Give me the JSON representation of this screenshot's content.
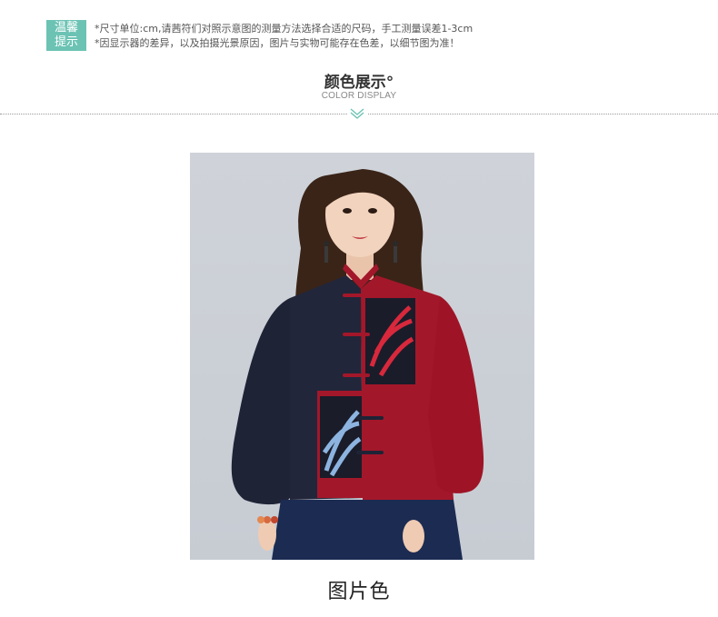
{
  "tip": {
    "badge_line1": "温馨",
    "badge_line2": "提示",
    "line1": "*尺寸单位:cm,请茜符们对照示意图的测量方法选择合适的尺码，手工测量误差1-3cm",
    "line2": "*因显示器的差异，以及拍摄光景原因，图片与实物可能存在色差，以细节图为准！"
  },
  "section": {
    "title": "颜色展示°",
    "subtitle": "COLOR DISPLAY"
  },
  "product": {
    "caption": "图片色"
  },
  "colors": {
    "accent": "#6cc3b4",
    "jacket_red": "#a3172a",
    "jacket_navy": "#1f2336"
  }
}
